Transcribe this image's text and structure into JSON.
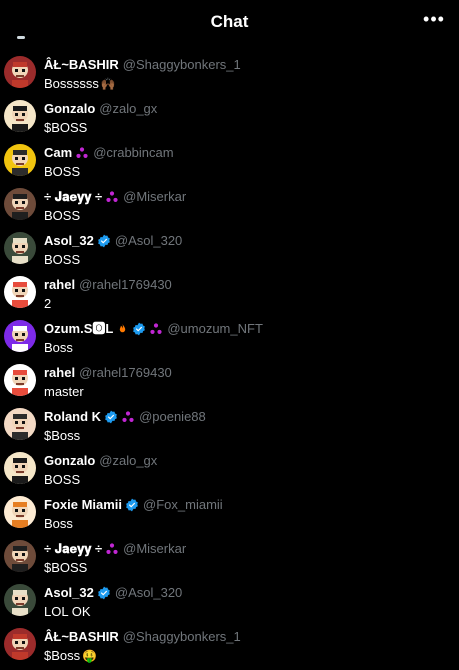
{
  "header": {
    "title": "Chat",
    "more_label": "•••"
  },
  "messages": [
    {
      "name": "ÂŁ~BASHIR",
      "handle": "@Shaggybonkers_1",
      "text": "Bossssss",
      "emoji": "🙌🏾",
      "verified": false,
      "fleet": false,
      "avatar_bg": "#9b2b2b",
      "avatar_fg": "#c0392b"
    },
    {
      "name": "Gonzalo",
      "handle": "@zalo_gx",
      "text": "$BOSS",
      "emoji": "",
      "verified": false,
      "fleet": false,
      "avatar_bg": "#f5e6c8",
      "avatar_fg": "#1a1a1a"
    },
    {
      "name": "Cam",
      "handle": "@crabbincam",
      "text": "BOSS",
      "emoji": "",
      "verified": false,
      "fleet": true,
      "avatar_bg": "#f1c40f",
      "avatar_fg": "#2c2c2c"
    },
    {
      "name": "÷ 𝐉𝐚𝐞𝐲𝐲 ÷",
      "handle": "@Miserkar",
      "text": "BOSS",
      "emoji": "",
      "verified": false,
      "fleet": true,
      "avatar_bg": "#6e4b3a",
      "avatar_fg": "#1f1f1f"
    },
    {
      "name": "Asol_32",
      "handle": "@Asol_320",
      "text": "BOSS",
      "emoji": "",
      "verified": true,
      "fleet": false,
      "avatar_bg": "#3a4a3a",
      "avatar_fg": "#e8e0c8"
    },
    {
      "name": "rahel",
      "handle": "@rahel1769430",
      "text": "2",
      "emoji": "",
      "verified": false,
      "fleet": false,
      "avatar_bg": "#ffffff",
      "avatar_fg": "#e74c3c"
    },
    {
      "name": "Ozum.S🅾L",
      "handle": "@umozum_NFT",
      "text": "Boss",
      "emoji": "",
      "verified": true,
      "fleet": true,
      "fire": true,
      "avatar_bg": "#7d2ae8",
      "avatar_fg": "#ffffff"
    },
    {
      "name": "rahel",
      "handle": "@rahel1769430",
      "text": "master",
      "emoji": "",
      "verified": false,
      "fleet": false,
      "avatar_bg": "#ffffff",
      "avatar_fg": "#e74c3c"
    },
    {
      "name": "Roland K",
      "handle": "@poenie88",
      "text": "$Boss",
      "emoji": "",
      "verified": true,
      "fleet": true,
      "avatar_bg": "#f3d9c4",
      "avatar_fg": "#2c2c2c"
    },
    {
      "name": "Gonzalo",
      "handle": "@zalo_gx",
      "text": "BOSS",
      "emoji": "",
      "verified": false,
      "fleet": false,
      "avatar_bg": "#f5e6c8",
      "avatar_fg": "#1a1a1a"
    },
    {
      "name": "Foxie Miamii",
      "handle": "@Fox_miamii",
      "text": "Boss",
      "emoji": "",
      "verified": true,
      "fleet": false,
      "avatar_bg": "#fdebd3",
      "avatar_fg": "#e67e22"
    },
    {
      "name": "÷ 𝐉𝐚𝐞𝐲𝐲 ÷",
      "handle": "@Miserkar",
      "text": "$BOSS",
      "emoji": "",
      "verified": false,
      "fleet": true,
      "avatar_bg": "#6e4b3a",
      "avatar_fg": "#1f1f1f"
    },
    {
      "name": "Asol_32",
      "handle": "@Asol_320",
      "text": "LOL OK",
      "emoji": "",
      "verified": true,
      "fleet": false,
      "avatar_bg": "#3a4a3a",
      "avatar_fg": "#e8e0c8"
    },
    {
      "name": "ÂŁ~BASHIR",
      "handle": "@Shaggybonkers_1",
      "text": "$Boss",
      "emoji": "🤑",
      "verified": false,
      "fleet": false,
      "avatar_bg": "#9b2b2b",
      "avatar_fg": "#c0392b"
    }
  ],
  "colors": {
    "verified": "#1d9bf0",
    "fleet": "#c026d3",
    "handle": "#71767b",
    "fire": "#ff7a00"
  }
}
